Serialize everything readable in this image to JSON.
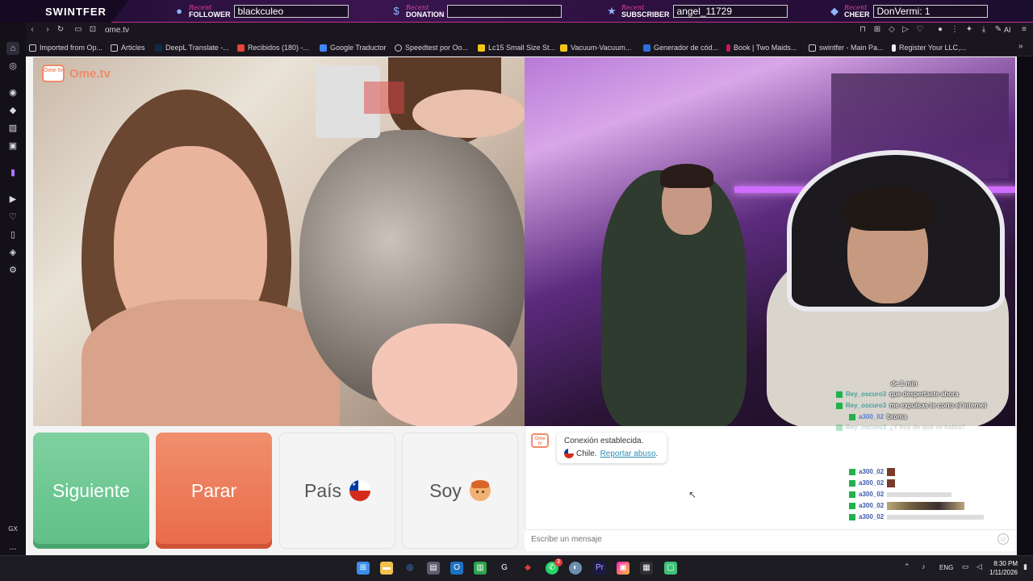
{
  "overlay": {
    "brand": "SWINTFER",
    "recent_word": "Recent",
    "follower_label": "FOLLOWER",
    "follower_value": "blackculeo",
    "donation_label": "DONATION",
    "donation_value": "",
    "subscriber_label": "SUBSCRIBER",
    "subscriber_value": "angel_11729",
    "cheer_label": "CHEER",
    "cheer_value": "DonVermi: 1"
  },
  "browser": {
    "url": "ome.tv",
    "ai_label": "AI",
    "bookmarks": [
      "Imported from Op...",
      "Articles",
      "DeepL Translate -...",
      "Recibidos (180) -...",
      "Google Traductor",
      "Speedtest por Oo...",
      "Lc15 Small Size St...",
      "Vacuum-Vacuum...",
      "Generador de cód...",
      "Book | Two Maids...",
      "swintfer - Main Pa...",
      "Register Your LLC,..."
    ]
  },
  "sidebar": {
    "gx_label": "GX",
    "more_label": "..."
  },
  "site": {
    "logo_icon_text": "Ome tv",
    "logo_text": "Ome.tv",
    "btn_next": "Siguiente",
    "btn_stop": "Parar",
    "btn_country": "País",
    "btn_gender": "Soy"
  },
  "chat": {
    "connected": "Conexión establecida.",
    "country": "Chile.",
    "report": "Reportar abuso",
    "report_dot": ".",
    "input_placeholder": "Escribe un mensaje"
  },
  "twitch_chat": {
    "time_label": "de 1 min",
    "messages": [
      {
        "user": "Rey_oscuro3",
        "text": "que despertaste ahora"
      },
      {
        "user": "Rey_oscuro3",
        "text": "me expulsas te corto el internet"
      },
      {
        "user": "a300_02",
        "text": "broma"
      },
      {
        "user": "Rey_oscuro3",
        "text": "¿Y hoy de qué se habla?"
      },
      {
        "user": "a300_02",
        "text": ""
      },
      {
        "user": "a300_02",
        "text": ""
      },
      {
        "user": "a300_02",
        "text": ""
      },
      {
        "user": "a300_02",
        "text": ""
      },
      {
        "user": "a300_02",
        "text": "https://youtube.com/shorts/..."
      },
      {
        "user": "a300_02",
        "text": ""
      }
    ]
  },
  "taskbar": {
    "lang": "ENG",
    "time": "8:30 PM",
    "date": "1/11/2026",
    "notif_count": "3"
  },
  "colors": {
    "next_green": "#6cc792",
    "stop_orange": "#ec7755",
    "brand_orange": "#f08a6a",
    "link_blue": "#2d8fb8",
    "overlay_pink": "#e0459a"
  }
}
